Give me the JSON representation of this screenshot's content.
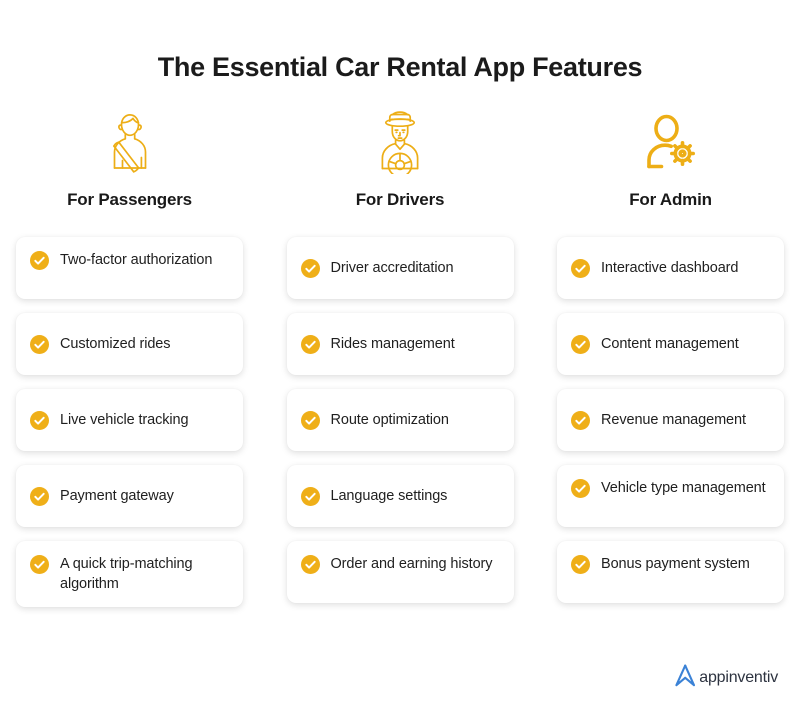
{
  "title": "The Essential Car Rental App Features",
  "colors": {
    "accent_yellow": "#EDAE16",
    "check_yellow": "#EFAF18",
    "title_text": "#1b1b1b",
    "card_text": "#1f1f1f",
    "logo_blue": "#3B82D6",
    "logo_text": "#2d3340",
    "background": "#ffffff"
  },
  "columns": [
    {
      "icon": "passenger-seatbelt-icon",
      "title": "For Passengers",
      "items": [
        {
          "label": "Two-factor authorization",
          "icon": "check-circle-icon"
        },
        {
          "label": "Customized rides",
          "icon": "check-circle-icon"
        },
        {
          "label": "Live vehicle tracking",
          "icon": "check-circle-icon"
        },
        {
          "label": "Payment gateway",
          "icon": "check-circle-icon"
        },
        {
          "label": "A quick trip-matching algorithm",
          "icon": "check-circle-icon"
        }
      ]
    },
    {
      "icon": "driver-cap-steering-wheel-icon",
      "title": "For Drivers",
      "items": [
        {
          "label": "Driver accreditation",
          "icon": "check-circle-icon"
        },
        {
          "label": "Rides management",
          "icon": "check-circle-icon"
        },
        {
          "label": "Route optimization",
          "icon": "check-circle-icon"
        },
        {
          "label": "Language settings",
          "icon": "check-circle-icon"
        },
        {
          "label": "Order and earning history",
          "icon": "check-circle-icon"
        }
      ]
    },
    {
      "icon": "admin-person-gear-icon",
      "title": "For Admin",
      "items": [
        {
          "label": "Interactive dashboard",
          "icon": "check-circle-icon"
        },
        {
          "label": "Content management",
          "icon": "check-circle-icon"
        },
        {
          "label": "Revenue management",
          "icon": "check-circle-icon"
        },
        {
          "label": "Vehicle type management",
          "icon": "check-circle-icon"
        },
        {
          "label": "Bonus payment system",
          "icon": "check-circle-icon"
        }
      ]
    }
  ],
  "footer": {
    "logo_mark": "appinventiv-arrow-logo-icon",
    "logo_text": "appinventiv"
  }
}
